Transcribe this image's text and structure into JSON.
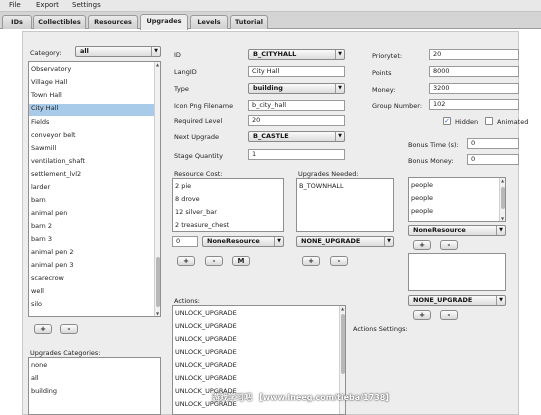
{
  "menu": [
    "File",
    "Export",
    "Settings"
  ],
  "tabs": [
    "IDs",
    "Collectibles",
    "Resources",
    "Upgrades",
    "Levels",
    "Tutorial"
  ],
  "active_tab": "Upgrades",
  "category": {
    "label": "Category:",
    "value": "all"
  },
  "upgrade_list": {
    "items": [
      "Observatory",
      "Village Hall",
      "Town Hall",
      "City Hall",
      "Fields",
      "conveyor belt",
      "Sawmill",
      "ventilation_shaft",
      "settlement_lvl2",
      "larder",
      "barn",
      "animal pen",
      "barn 2",
      "barn 3",
      "animal pen 2",
      "animal pen 3",
      "scarecrow",
      "well",
      "silo"
    ],
    "selected": "City Hall"
  },
  "list_buttons": {
    "add": "+",
    "remove": "-",
    "m": "M"
  },
  "categories": {
    "label": "Upgrades Categories:",
    "items": [
      "none",
      "all",
      "building"
    ]
  },
  "form": {
    "id_label": "ID",
    "id_value": "B_CITYHALL",
    "langid_label": "LangID",
    "langid_value": "City Hall",
    "type_label": "Type",
    "type_value": "building",
    "icon_label": "Icon Png Filename",
    "icon_value": "b_city_hall",
    "reqlevel_label": "Required Level",
    "reqlevel_value": "20",
    "next_label": "Next Upgrade",
    "next_value": "B_CASTLE",
    "stage_label": "Stage Quantity",
    "stage_value": "1"
  },
  "right_form": {
    "priority_label": "Priorytet:",
    "priority_value": "20",
    "points_label": "Points",
    "points_value": "8000",
    "money_label": "Money:",
    "money_value": "3200",
    "group_label": "Group Number:",
    "group_value": "102",
    "hidden_label": "Hidden",
    "hidden_checked": true,
    "animated_label": "Animated",
    "animated_checked": false,
    "bonus_time_label": "Bonus Time (s):",
    "bonus_time_value": "0",
    "bonus_money_label": "Bonus Money:",
    "bonus_money_value": "0"
  },
  "resource_cost": {
    "label": "Resource Cost:",
    "items": [
      "2 pie",
      "8 drove",
      "12 silver_bar",
      "2 treasure_chest"
    ],
    "qty": "0",
    "resource_combo": "NoneResource"
  },
  "upgrades_needed": {
    "label": "Upgrades Needed:",
    "items": [
      "B_TOWNHALL"
    ],
    "combo": "NONE_UPGRADE"
  },
  "people_list": {
    "items": [
      "people",
      "people",
      "people"
    ],
    "combo": "NoneResource",
    "combo2": "NONE_UPGRADE"
  },
  "actions": {
    "label": "Actions:",
    "items": [
      "UNLOCK_UPGRADE",
      "UNLOCK_UPGRADE",
      "UNLOCK_UPGRADE",
      "UNLOCK_UPGRADE",
      "UNLOCK_UPGRADE",
      "UNLOCK_UPGRADE",
      "UNLOCK_UPGRADE",
      "UNLOCK_UPGRADE"
    ]
  },
  "actions_settings": {
    "label": "Actions Settings:"
  },
  "watermark": "游戏学习吧 【www.lneeg.com/tieba/1738】"
}
